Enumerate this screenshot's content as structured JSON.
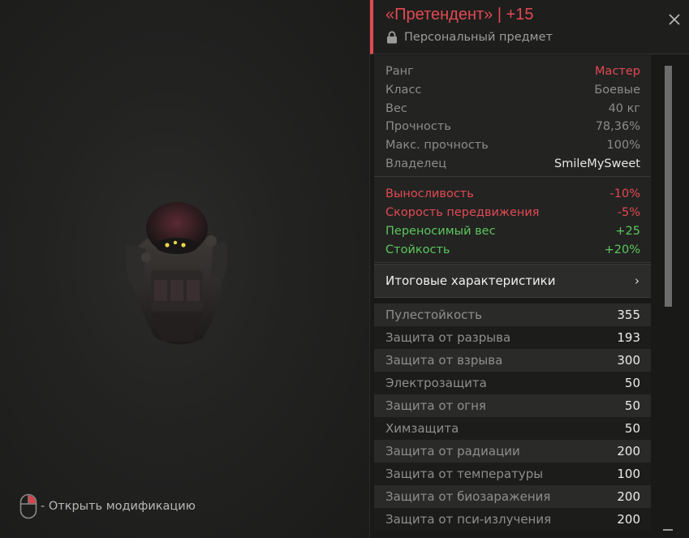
{
  "viewport": {
    "hint_text": "- Открыть модификацию"
  },
  "header": {
    "title": "«Претендент» | +15",
    "subtitle": "Персональный предмет"
  },
  "info": [
    {
      "label": "Ранг",
      "value": "Мастер"
    },
    {
      "label": "Класс",
      "value": "Боевые"
    },
    {
      "label": "Вес",
      "value": "40 кг"
    },
    {
      "label": "Прочность",
      "value": "78,36%"
    },
    {
      "label": "Макс. прочность",
      "value": "100%"
    },
    {
      "label": "Владелец",
      "value": "SmileMySweet"
    }
  ],
  "effects": [
    {
      "label": "Выносливость",
      "value": "-10%",
      "kind": "negative"
    },
    {
      "label": "Скорость передвижения",
      "value": "-5%",
      "kind": "negative"
    },
    {
      "label": "Переносимый вес",
      "value": "+25",
      "kind": "positive"
    },
    {
      "label": "Стойкость",
      "value": "+20%",
      "kind": "positive"
    }
  ],
  "summary": {
    "label": "Итоговые характеристики",
    "chevron": "›"
  },
  "stats": [
    {
      "label": "Пулестойкость",
      "value": "355"
    },
    {
      "label": "Защита от разрыва",
      "value": "193"
    },
    {
      "label": "Защита от взрыва",
      "value": "300"
    },
    {
      "label": "Электрозащита",
      "value": "50"
    },
    {
      "label": "Защита от огня",
      "value": "50"
    },
    {
      "label": "Химзащита",
      "value": "50"
    },
    {
      "label": "Защита от радиации",
      "value": "200"
    },
    {
      "label": "Защита от температуры",
      "value": "100"
    },
    {
      "label": "Защита от биозаражения",
      "value": "200"
    },
    {
      "label": "Защита от пси-излучения",
      "value": "200"
    }
  ],
  "colors": {
    "accent_red": "#e24a52",
    "positive_green": "#5cc65c",
    "panel_bg": "#191918"
  },
  "icons": {
    "close": "close-icon",
    "lock": "lock-icon",
    "mouse": "mouse-right-click-icon"
  }
}
